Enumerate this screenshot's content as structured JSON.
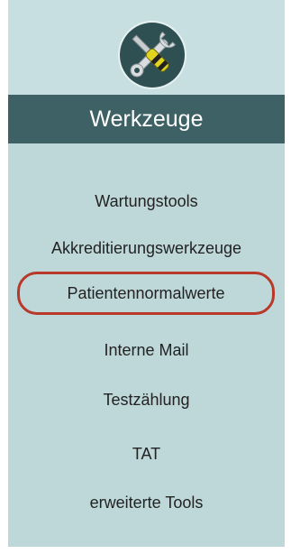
{
  "panel": {
    "title": "Werkzeuge",
    "icon": "wrench-screwdriver-icon"
  },
  "menu": {
    "items": [
      {
        "label": "Wartungstools"
      },
      {
        "label": "Akkreditierungswerkzeuge"
      },
      {
        "label": "Patientennormalwerte",
        "highlighted": true
      },
      {
        "label": "Interne Mail"
      },
      {
        "label": "Testzählung"
      },
      {
        "label": "TAT"
      },
      {
        "label": "erweiterte Tools"
      }
    ]
  },
  "colors": {
    "panel_bg": "#bed8d9",
    "title_bar_bg": "#3e6165",
    "highlight_border": "#b8392a"
  }
}
